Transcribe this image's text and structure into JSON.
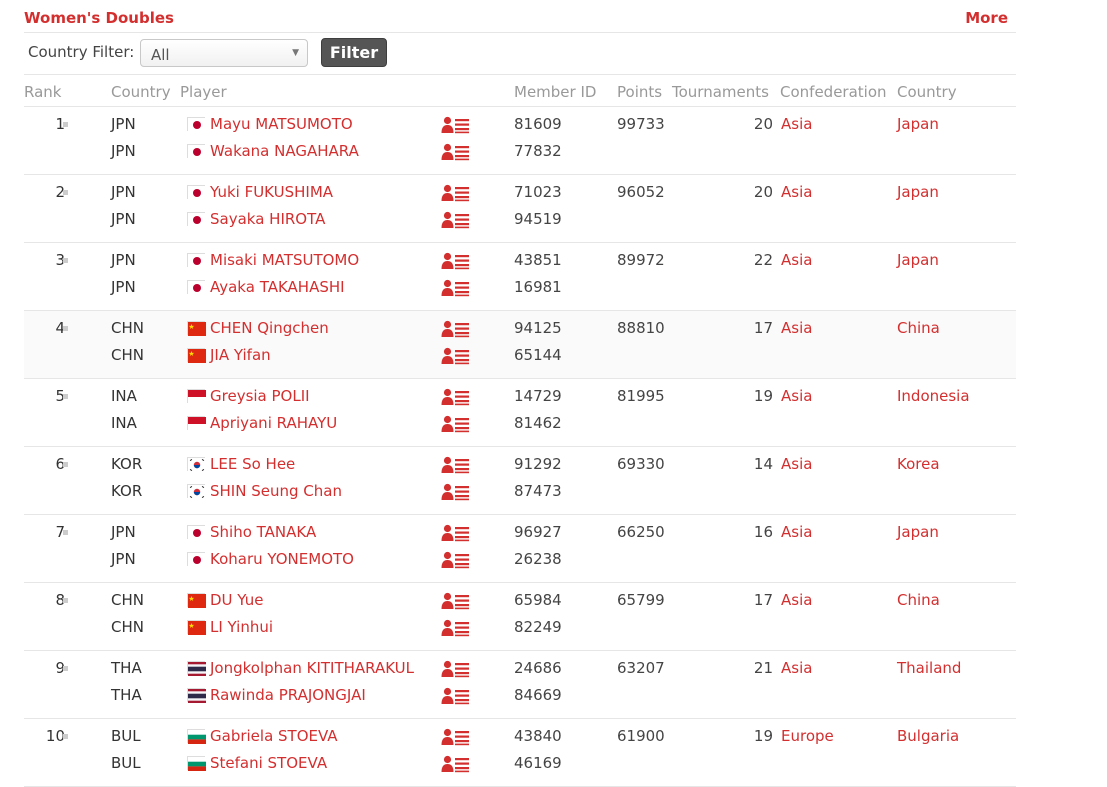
{
  "header": {
    "title": "Women's Doubles",
    "more": "More"
  },
  "filter": {
    "label": "Country Filter:",
    "selected": "All",
    "button": "Filter"
  },
  "columns": {
    "rank": "Rank",
    "country": "Country",
    "player": "Player",
    "member_id": "Member ID",
    "points": "Points",
    "tournaments": "Tournaments",
    "confederation": "Confederation",
    "country_name": "Country"
  },
  "rows": [
    {
      "rank": "1",
      "points": "99733",
      "tournaments": "20",
      "confederation": "Asia",
      "country": "Japan",
      "flag": "JPN",
      "players": [
        {
          "code": "JPN",
          "name": "Mayu MATSUMOTO",
          "id": "81609"
        },
        {
          "code": "JPN",
          "name": "Wakana NAGAHARA",
          "id": "77832"
        }
      ]
    },
    {
      "rank": "2",
      "points": "96052",
      "tournaments": "20",
      "confederation": "Asia",
      "country": "Japan",
      "flag": "JPN",
      "players": [
        {
          "code": "JPN",
          "name": "Yuki FUKUSHIMA",
          "id": "71023"
        },
        {
          "code": "JPN",
          "name": "Sayaka HIROTA",
          "id": "94519"
        }
      ]
    },
    {
      "rank": "3",
      "points": "89972",
      "tournaments": "22",
      "confederation": "Asia",
      "country": "Japan",
      "flag": "JPN",
      "players": [
        {
          "code": "JPN",
          "name": "Misaki MATSUTOMO",
          "id": "43851"
        },
        {
          "code": "JPN",
          "name": "Ayaka TAKAHASHI",
          "id": "16981"
        }
      ]
    },
    {
      "rank": "4",
      "points": "88810",
      "tournaments": "17",
      "confederation": "Asia",
      "country": "China",
      "flag": "CHN",
      "players": [
        {
          "code": "CHN",
          "name": "CHEN Qingchen",
          "id": "94125"
        },
        {
          "code": "CHN",
          "name": "JIA Yifan",
          "id": "65144"
        }
      ]
    },
    {
      "rank": "5",
      "points": "81995",
      "tournaments": "19",
      "confederation": "Asia",
      "country": "Indonesia",
      "flag": "INA",
      "players": [
        {
          "code": "INA",
          "name": "Greysia POLII",
          "id": "14729"
        },
        {
          "code": "INA",
          "name": "Apriyani RAHAYU",
          "id": "81462"
        }
      ]
    },
    {
      "rank": "6",
      "points": "69330",
      "tournaments": "14",
      "confederation": "Asia",
      "country": "Korea",
      "flag": "KOR",
      "players": [
        {
          "code": "KOR",
          "name": "LEE So Hee",
          "id": "91292"
        },
        {
          "code": "KOR",
          "name": "SHIN Seung Chan",
          "id": "87473"
        }
      ]
    },
    {
      "rank": "7",
      "points": "66250",
      "tournaments": "16",
      "confederation": "Asia",
      "country": "Japan",
      "flag": "JPN",
      "players": [
        {
          "code": "JPN",
          "name": "Shiho TANAKA",
          "id": "96927"
        },
        {
          "code": "JPN",
          "name": "Koharu YONEMOTO",
          "id": "26238"
        }
      ]
    },
    {
      "rank": "8",
      "points": "65799",
      "tournaments": "17",
      "confederation": "Asia",
      "country": "China",
      "flag": "CHN",
      "players": [
        {
          "code": "CHN",
          "name": "DU Yue",
          "id": "65984"
        },
        {
          "code": "CHN",
          "name": "LI Yinhui",
          "id": "82249"
        }
      ]
    },
    {
      "rank": "9",
      "points": "63207",
      "tournaments": "21",
      "confederation": "Asia",
      "country": "Thailand",
      "flag": "THA",
      "players": [
        {
          "code": "THA",
          "name": "Jongkolphan KITITHARAKUL",
          "id": "24686"
        },
        {
          "code": "THA",
          "name": "Rawinda PRAJONGJAI",
          "id": "84669"
        }
      ]
    },
    {
      "rank": "10",
      "points": "61900",
      "tournaments": "19",
      "confederation": "Europe",
      "country": "Bulgaria",
      "flag": "BUL",
      "players": [
        {
          "code": "BUL",
          "name": "Gabriela STOEVA",
          "id": "43840"
        },
        {
          "code": "BUL",
          "name": "Stefani STOEVA",
          "id": "46169"
        }
      ]
    }
  ],
  "colors": {
    "accent": "#d32f2f",
    "filter_button": "#555555",
    "muted": "#999999"
  },
  "icons": {
    "player_profile": "player-profile-icon",
    "rank_marker": "rank-marker-icon"
  }
}
